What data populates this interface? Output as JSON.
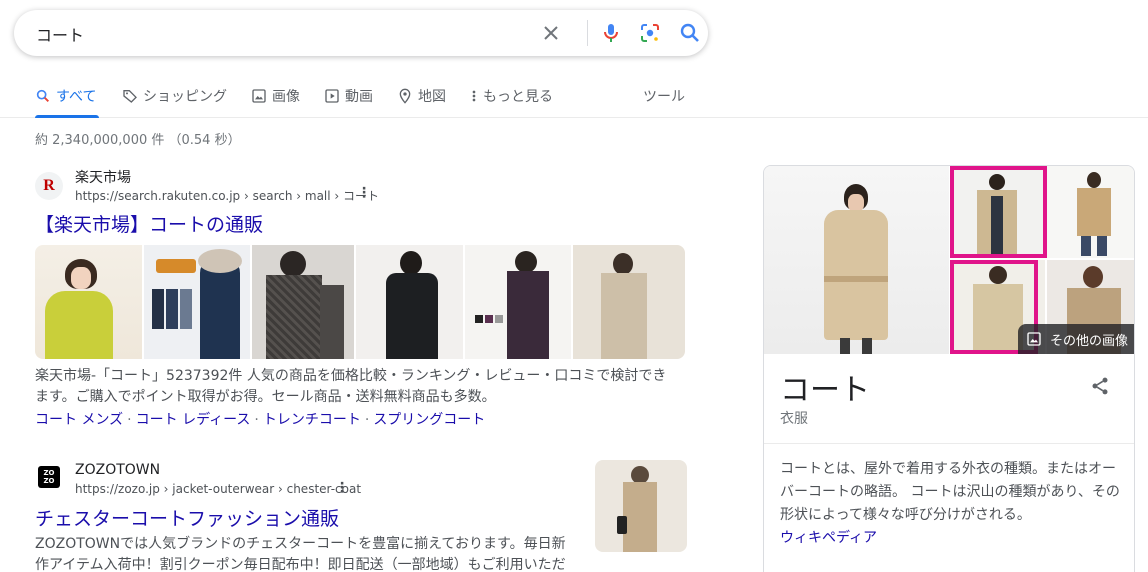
{
  "search": {
    "query": "コート"
  },
  "tabs": [
    {
      "label": "すべて"
    },
    {
      "label": "ショッピング"
    },
    {
      "label": "画像"
    },
    {
      "label": "動画"
    },
    {
      "label": "地図"
    },
    {
      "label": "もっと見る"
    }
  ],
  "tools_label": "ツール",
  "stats": "約 2,340,000,000 件 （0.54 秒）",
  "results": [
    {
      "site_name": "楽天市場",
      "url": "https://search.rakuten.co.jp › search › mall › コート",
      "title": "【楽天市場】コートの通販",
      "snippet": "楽天市場-「コート」5237392件 人気の商品を価格比較・ランキング・レビュー・口コミで検討できます。ご購入でポイント取得がお得。セール商品・送料無料商品も多数。",
      "sublinks": [
        "コート メンズ",
        "コート レディース",
        "トレンチコート",
        "スプリングコート"
      ]
    },
    {
      "site_name": "ZOZOTOWN",
      "url": "https://zozo.jp › jacket-outerwear › chester-coat",
      "title": "チェスターコートファッション通販",
      "snippet": "ZOZOTOWNでは人気ブランドのチェスターコートを豊富に揃えております。毎日新作アイテム入荷中！割引クーポン毎日配布中！即日配送（一部地域）もご利用いただ"
    }
  ],
  "knowledge_panel": {
    "title": "コート",
    "subtitle": "衣服",
    "more_images_label": "その他の画像",
    "description": "コートとは、屋外で着用する外衣の種類。またはオーバーコートの略語。 コートは沢山の種類があり、その形状によって様々な呼び分けがされる。",
    "source_link": "ウィキペディア"
  },
  "colors": {
    "accent": "#1a73e8",
    "link": "#1a0dab",
    "highlight": "#e0148a"
  }
}
